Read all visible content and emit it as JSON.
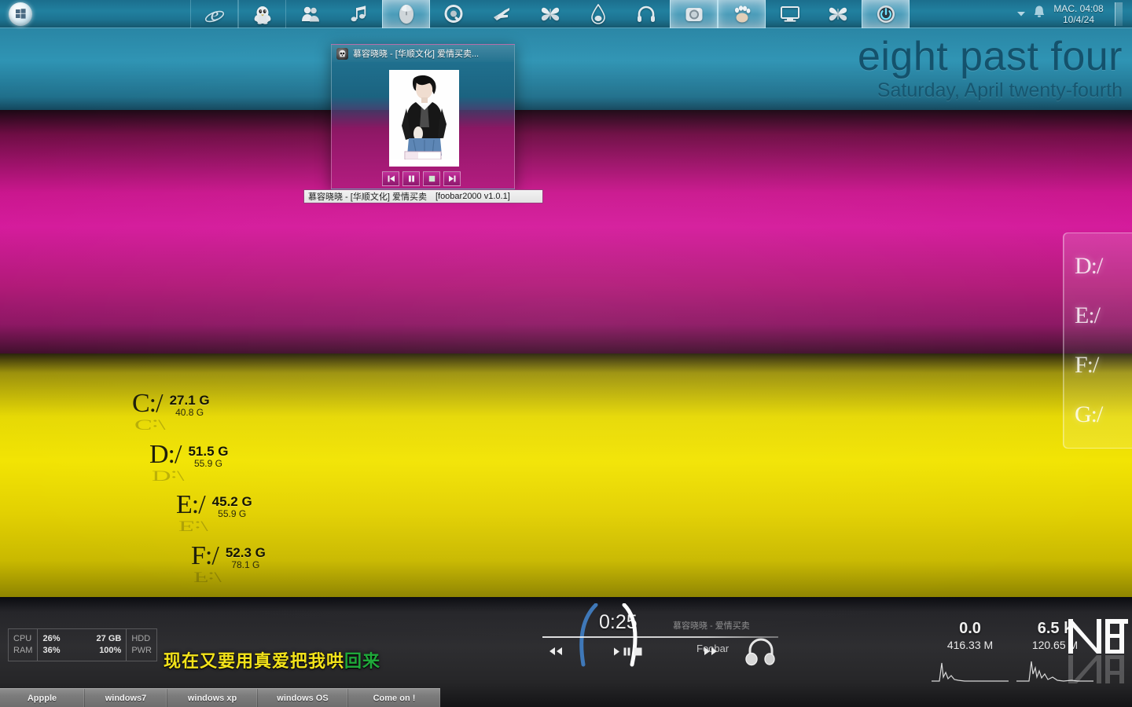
{
  "dock": {
    "start_icon": "windows-logo-icon",
    "items": [
      {
        "name": "internet-explorer-icon",
        "label": "Internet Explorer",
        "active": false,
        "slot": true
      },
      {
        "name": "qq-penguin-icon",
        "label": "QQ",
        "active": false,
        "slot": true
      },
      {
        "name": "contacts-icon",
        "label": "Contacts",
        "active": false,
        "slot": false
      },
      {
        "name": "music-note-icon",
        "label": "Music",
        "active": false,
        "slot": false
      },
      {
        "name": "mouse-icon",
        "label": "Mouse",
        "active": true,
        "slot": false
      },
      {
        "name": "qq-music-icon",
        "label": "QQ Music",
        "active": false,
        "slot": false
      },
      {
        "name": "hand-pointer-icon",
        "label": "Pointer",
        "active": false,
        "slot": false
      },
      {
        "name": "butterfly-icon",
        "label": "Butterfly",
        "active": false,
        "slot": false
      },
      {
        "name": "water-drop-icon",
        "label": "Water Drop",
        "active": false,
        "slot": false
      },
      {
        "name": "headphones-icon",
        "label": "Headphones",
        "active": false,
        "slot": false
      },
      {
        "name": "camera-icon",
        "label": "Camera",
        "active": true,
        "slot": false
      },
      {
        "name": "paw-print-icon",
        "label": "Paw",
        "active": true,
        "slot": false
      },
      {
        "name": "monitor-icon",
        "label": "Monitor",
        "active": false,
        "slot": false
      },
      {
        "name": "butterfly-alt-icon",
        "label": "Butterfly",
        "active": false,
        "slot": false
      },
      {
        "name": "power-icon",
        "label": "Power",
        "active": true,
        "slot": false
      }
    ]
  },
  "tray": {
    "chevron_icon": "chevron-down-icon",
    "notification_icon": "bell-icon",
    "clock_time": "MAC. 04:08",
    "clock_date": "10/4/24"
  },
  "wordclock": {
    "time": "eight past four",
    "date": "Saturday, April twenty-fourth"
  },
  "foobar": {
    "window_icon": "skull-icon",
    "title": "慕容晓晓 - [华顺文化] 爱情买卖...",
    "statusbar_track": "慕容晓晓 - [华顺文化] 爱情买卖",
    "statusbar_app": "[foobar2000 v1.0.1]",
    "buttons": [
      {
        "name": "previous-button",
        "glyph": "previous"
      },
      {
        "name": "pause-button",
        "glyph": "pause"
      },
      {
        "name": "stop-button",
        "glyph": "stop"
      },
      {
        "name": "next-button",
        "glyph": "next"
      }
    ]
  },
  "drive_gauges": [
    {
      "letter": "C:/",
      "free": "27.1 G",
      "total": "40.8 G"
    },
    {
      "letter": "D:/",
      "free": "51.5 G",
      "total": "55.9 G"
    },
    {
      "letter": "E:/",
      "free": "45.2 G",
      "total": "55.9 G"
    },
    {
      "letter": "F:/",
      "free": "52.3 G",
      "total": "78.1 G"
    }
  ],
  "drive_panel": [
    {
      "letter": "D:/"
    },
    {
      "letter": "E:/"
    },
    {
      "letter": "F:/"
    },
    {
      "letter": "G:/"
    }
  ],
  "sysmon": {
    "cpu_label": "CPU",
    "cpu_value": "26%",
    "ram_label": "RAM",
    "ram_value": "36%",
    "hdd_label": "HDD",
    "hdd_value": "27 GB",
    "pwr_label": "PWR",
    "pwr_value": "100%"
  },
  "lyrics": {
    "sung": "现在又要用真爱把我哄",
    "unsung": "回来"
  },
  "player": {
    "time": "0:25",
    "track": "慕容晓晓 - 爱情买卖",
    "source": "Foobar",
    "prev_icon": "rewind-icon",
    "play_icon": "play-icon",
    "pause_icon": "pause-icon",
    "stop_icon": "stop-icon",
    "next_icon": "fast-forward-icon",
    "headphones_icon": "headphones-icon"
  },
  "netmon": {
    "up_rate": "0.0",
    "down_rate": "6.5 k",
    "up_total": "416.33 M",
    "down_total": "120.65 M",
    "logo": "NET"
  },
  "taskbar": {
    "items": [
      {
        "label": "Appple"
      },
      {
        "label": "windows7"
      },
      {
        "label": "windows xp"
      },
      {
        "label": "windows OS"
      },
      {
        "label": "Come on !"
      }
    ]
  },
  "colors": {
    "teal": "#2a87a6",
    "magenta": "#c9138c",
    "yellow": "#e6d800",
    "dark": "#2e2e31",
    "lyric_sung": "#f2e21a",
    "lyric_unsung": "#1fa83a"
  }
}
